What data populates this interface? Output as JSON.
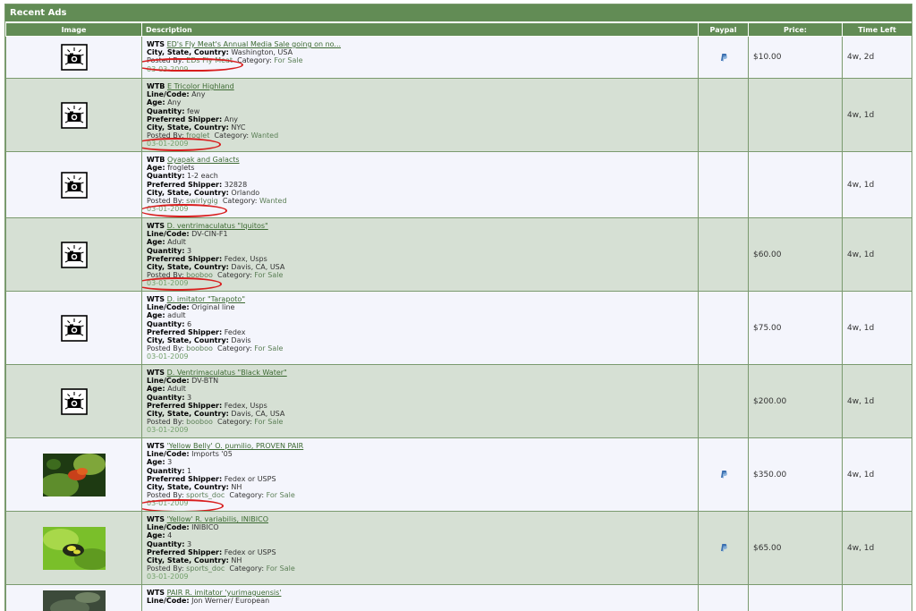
{
  "panel": {
    "title": "Recent Ads"
  },
  "columns": [
    "Image",
    "Description",
    "Paypal",
    "Price:",
    "Time Left"
  ],
  "labels": {
    "line_code": "Line/Code:",
    "age": "Age:",
    "quantity": "Quantity:",
    "shipper": "Preferred Shipper:",
    "location": "City, State, Country:",
    "posted_by": "Posted By:",
    "category": "Category:"
  },
  "rows": [
    {
      "type": "WTS",
      "title": "ED's Fly Meat's Annual Media Sale going on no...",
      "location": "Washington, USA",
      "poster": "EDs Fly Meat",
      "category": "For Sale",
      "date": "03-03-2009",
      "paypal": true,
      "price": "$10.00",
      "time_left": "4w, 2d",
      "image": "camera"
    },
    {
      "type": "WTB",
      "title": "E Tricolor Highland",
      "line_code": "Any",
      "age": "Any",
      "quantity": "few",
      "shipper": "Any",
      "location": "NYC",
      "poster": "froglet",
      "category": "Wanted",
      "date": "03-01-2009",
      "paypal": false,
      "price": "",
      "time_left": "4w, 1d",
      "image": "camera"
    },
    {
      "type": "WTB",
      "title": "Oyapak and Galacts",
      "age": "froglets",
      "quantity": "1-2 each",
      "shipper": "32828",
      "location": "Orlando",
      "poster": "swirlygig",
      "category": "Wanted",
      "date": "03-01-2009",
      "paypal": false,
      "price": "",
      "time_left": "4w, 1d",
      "image": "camera"
    },
    {
      "type": "WTS",
      "title": "D. ventrimaculatus \"Iquitos\"",
      "line_code": "DV-CIN-F1",
      "age": "Adult",
      "quantity": "3",
      "shipper": "Fedex, Usps",
      "location": "Davis, CA, USA",
      "poster": "booboo",
      "category": "For Sale",
      "date": "03-01-2009",
      "paypal": false,
      "price": "$60.00",
      "time_left": "4w, 1d",
      "image": "camera"
    },
    {
      "type": "WTS",
      "title": "D. imitator \"Tarapoto\"",
      "line_code": "Original line",
      "age": "adult",
      "quantity": "6",
      "shipper": "Fedex",
      "location": "Davis",
      "poster": "booboo",
      "category": "For Sale",
      "date": "03-01-2009",
      "paypal": false,
      "price": "$75.00",
      "time_left": "4w, 1d",
      "image": "camera"
    },
    {
      "type": "WTS",
      "title": "D. Ventrimaculatus \"Black Water\"",
      "line_code": "DV-BTN",
      "age": "Adult",
      "quantity": "3",
      "shipper": "Fedex, Usps",
      "location": "Davis, CA, USA",
      "poster": "booboo",
      "category": "For Sale",
      "date": "03-01-2009",
      "paypal": false,
      "price": "$200.00",
      "time_left": "4w, 1d",
      "image": "camera"
    },
    {
      "type": "WTS",
      "title": "'Yellow Belly' O. pumilio, PROVEN PAIR",
      "line_code": "Imports '05",
      "age": "3",
      "quantity": "1",
      "shipper": "Fedex or USPS",
      "location": "NH",
      "poster": "sports_doc",
      "category": "For Sale",
      "date": "03-01-2009",
      "paypal": true,
      "price": "$350.00",
      "time_left": "4w, 1d",
      "image": "photo-red"
    },
    {
      "type": "WTS",
      "title": "'Yellow' R. variabilis, INIBICO",
      "line_code": "INIBICO",
      "age": "4",
      "quantity": "3",
      "shipper": "Fedex or USPS",
      "location": "NH",
      "poster": "sports_doc",
      "category": "For Sale",
      "date": "03-01-2009",
      "paypal": true,
      "price": "$65.00",
      "time_left": "4w, 1d",
      "image": "photo-green"
    },
    {
      "type": "WTS",
      "title": "PAIR R. imitator 'yurimaguensis'",
      "line_code": "Jon Werner/ European",
      "paypal": false,
      "price": "",
      "time_left": "",
      "image": "photo-dark"
    }
  ]
}
